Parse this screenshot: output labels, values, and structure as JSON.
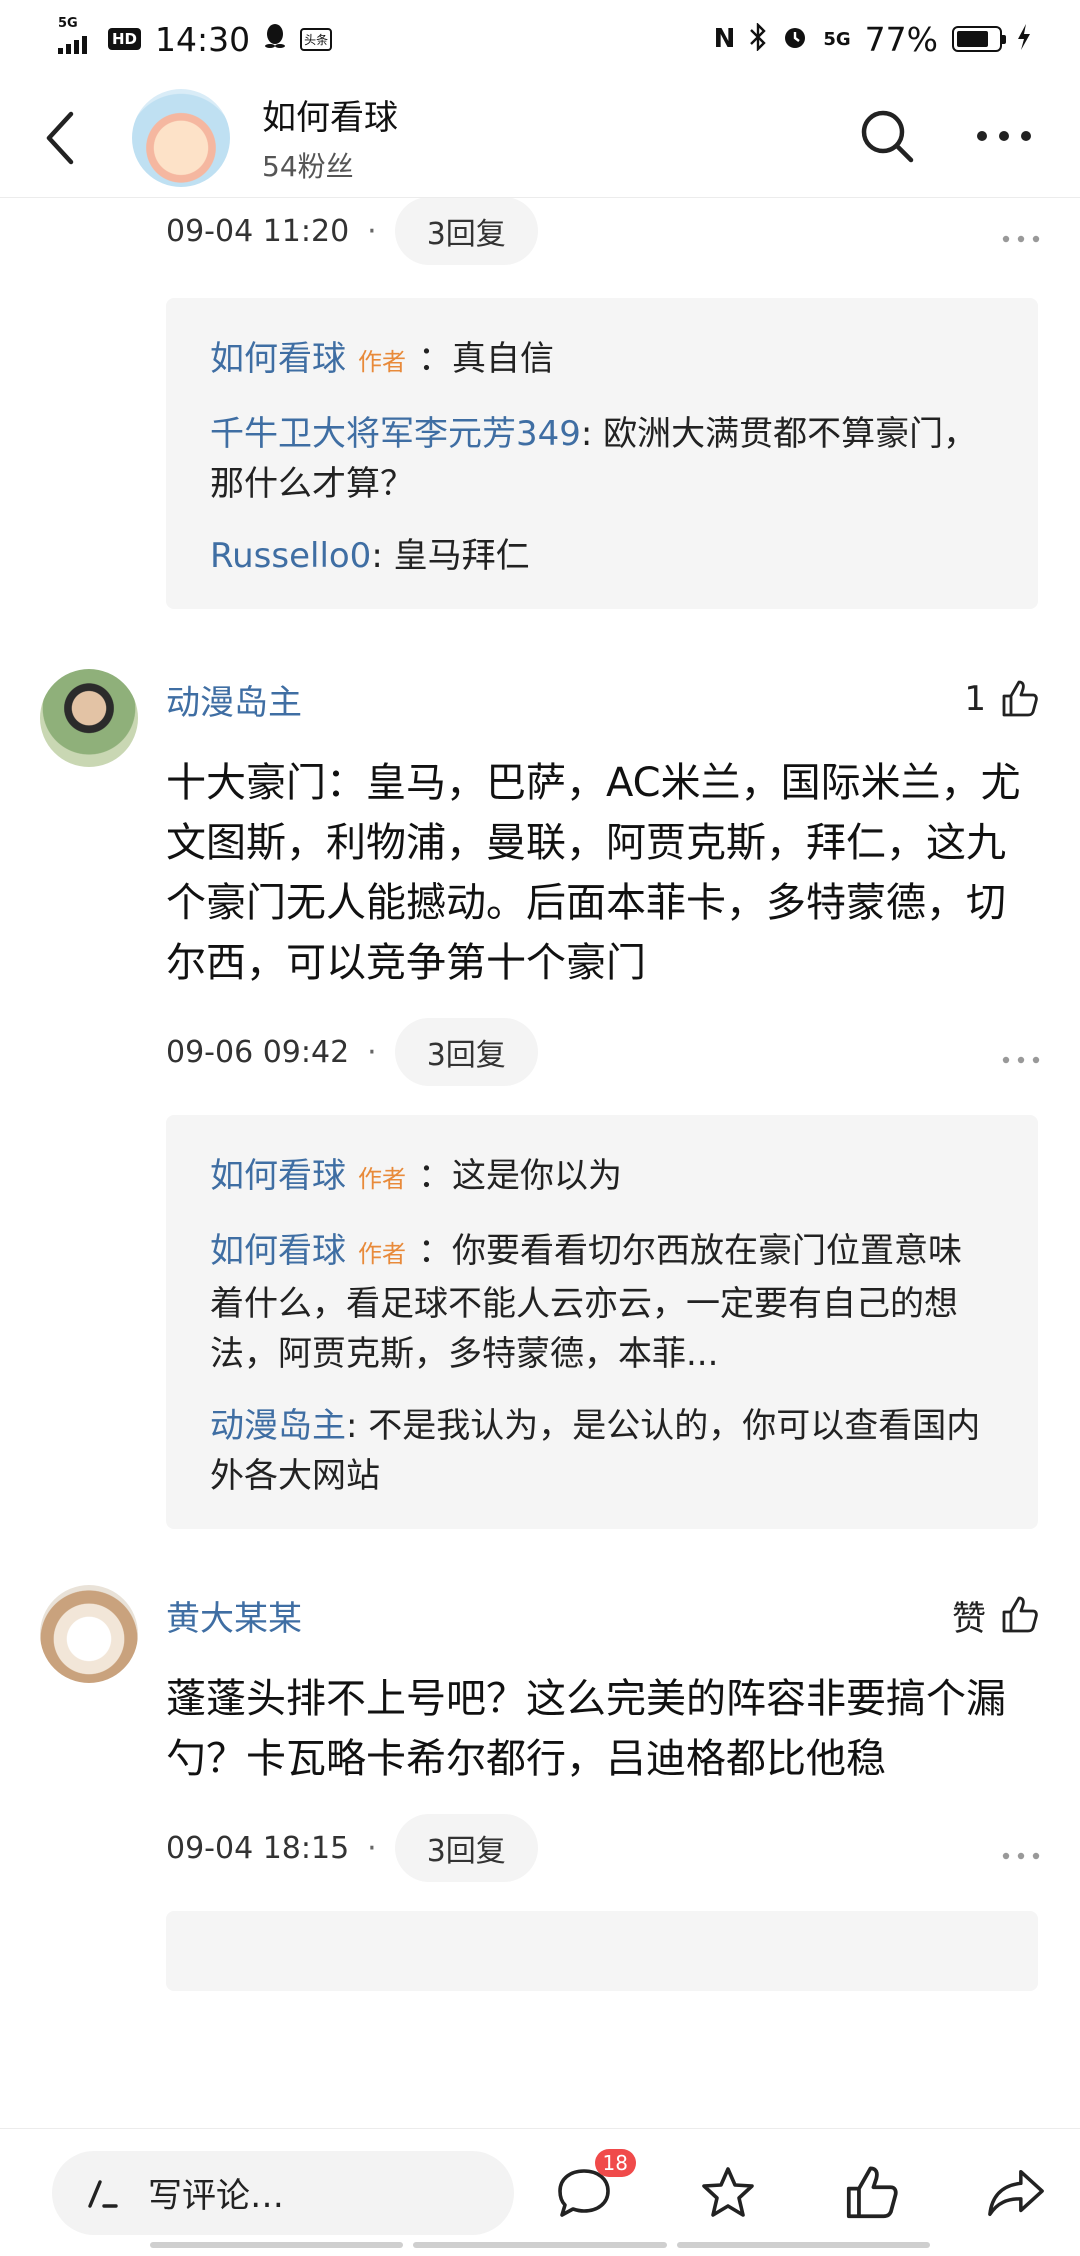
{
  "status_bar": {
    "network": "5G",
    "hd": "HD",
    "time": "14:30",
    "app_badge": "头条",
    "nfc": "N",
    "network_right": "5G",
    "battery_percent": "77%",
    "battery_level": 0.77
  },
  "header": {
    "title": "如何看球",
    "subtitle": "54粉丝"
  },
  "top_meta": {
    "time": "09-04 11:20",
    "dot": "·",
    "replies": "3回复"
  },
  "reply_box_1": [
    {
      "user": "如何看球",
      "author_tag": "作者",
      "text": "：真自信"
    },
    {
      "user": "千牛卫大将军李元芳349",
      "author_tag": "",
      "text": ": 欧洲大满贯都不算豪门，那什么才算？"
    },
    {
      "user": "Russello0",
      "author_tag": "",
      "text": ": 皇马拜仁"
    }
  ],
  "comments": [
    {
      "name": "动漫岛主",
      "like": "1",
      "body": "十大豪门：皇马，巴萨，AC米兰，国际米兰，尤文图斯，利物浦，曼联，阿贾克斯，拜仁，这九个豪门无人能撼动。后面本菲卡，多特蒙德，切尔西，可以竞争第十个豪门",
      "time": "09-06 09:42",
      "dot": "·",
      "replies": "3回复"
    },
    {
      "name": "黄大某某",
      "like": "赞",
      "body": "蓬蓬头排不上号吧？这么完美的阵容非要搞个漏勺？卡瓦略卡希尔都行，吕迪格都比他稳",
      "time": "09-04 18:15",
      "dot": "·",
      "replies": "3回复"
    }
  ],
  "reply_box_2": [
    {
      "user": "如何看球",
      "author_tag": "作者",
      "text": "：这是你以为"
    },
    {
      "user": "如何看球",
      "author_tag": "作者",
      "text": "：你要看看切尔西放在豪门位置意味着什么，看足球不能人云亦云，一定要有自己的想法，阿贾克斯，多特蒙德，本菲..."
    },
    {
      "user": "动漫岛主",
      "author_tag": "",
      "text": ": 不是我认为，是公认的，你可以查看国内外各大网站"
    }
  ],
  "bottom_bar": {
    "write_placeholder": "写评论…",
    "comment_count": "18"
  }
}
